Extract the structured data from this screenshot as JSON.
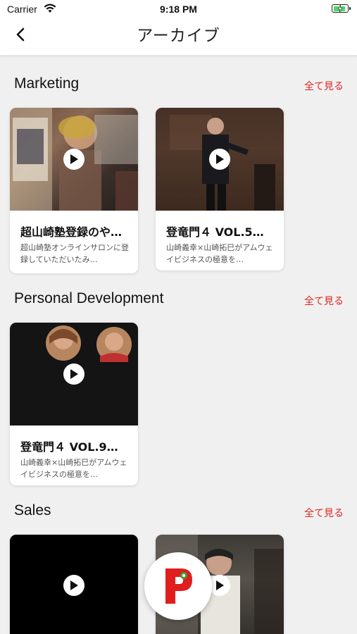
{
  "status_bar": {
    "carrier": "Carrier",
    "time": "9:18 PM"
  },
  "header": {
    "title": "アーカイブ",
    "back_icon": "chevron-left-icon"
  },
  "colors": {
    "accent": "#e02424",
    "background": "#f0f0f0"
  },
  "sections": [
    {
      "title": "Marketing",
      "see_all": "全て見る",
      "cards": [
        {
          "title": "超山崎塾登録のや…",
          "desc": "超山崎塾オンラインサロンに登録していただいたみ…"
        },
        {
          "title": "登竜門４ VOL.5…",
          "desc": "山崎義幸×山崎拓巳がアムウェイビジネスの極意を…"
        }
      ]
    },
    {
      "title": "Personal Development",
      "see_all": "全て見る",
      "cards": [
        {
          "title": "登竜門４ VOL.9…",
          "desc": "山崎義幸×山崎拓巳がアムウェイビジネスの極意を…"
        }
      ]
    },
    {
      "title": "Sales",
      "see_all": "全て見る",
      "cards": [
        {},
        {}
      ]
    }
  ],
  "fab": {
    "icon": "app-logo-icon"
  }
}
